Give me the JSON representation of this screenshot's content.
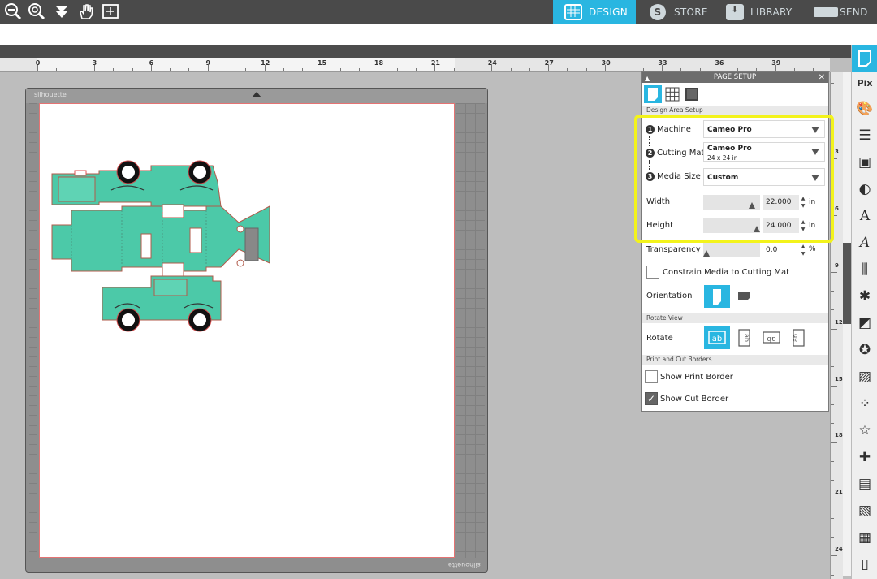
{
  "nav": {
    "tabs": [
      {
        "label": "DESIGN",
        "icon": "grid-icon",
        "active": true
      },
      {
        "label": "STORE",
        "icon": "store-s-icon",
        "active": false
      },
      {
        "label": "LIBRARY",
        "icon": "library-icon",
        "active": false
      },
      {
        "label": "SEND",
        "icon": "send-cutter-icon",
        "active": false
      }
    ],
    "tools": [
      "zoom-out-icon",
      "zoom-select-icon",
      "pan-down-icon",
      "hand-icon",
      "fit-page-icon"
    ]
  },
  "ruler": {
    "labels": [
      "0",
      "3",
      "6",
      "9",
      "12",
      "15",
      "18",
      "21",
      "24",
      "27",
      "30",
      "33",
      "36",
      "39"
    ],
    "vlabels": [
      "3",
      "6",
      "9",
      "12",
      "15",
      "18",
      "21",
      "24"
    ]
  },
  "mat": {
    "brand_top": "silhouette",
    "brand_bottom": "silhouette"
  },
  "panel": {
    "title": "PAGE SETUP",
    "section_design": "Design Area Setup",
    "machine": {
      "num": "1",
      "label": "Machine",
      "value": "Cameo Pro"
    },
    "cutting_mat": {
      "num": "2",
      "label": "Cutting Mat",
      "value": "Cameo Pro",
      "sub": "24 x 24 in"
    },
    "media_size": {
      "num": "3",
      "label": "Media Size",
      "value": "Custom"
    },
    "width": {
      "label": "Width",
      "value": "22.000",
      "unit": "in"
    },
    "height": {
      "label": "Height",
      "value": "24.000",
      "unit": "in"
    },
    "transparency": {
      "label": "Transparency",
      "value": "0.0",
      "unit": "%"
    },
    "constrain_label": "Constrain Media to Cutting Mat",
    "orientation_label": "Orientation",
    "section_rotate": "Rotate View",
    "rotate_label": "Rotate",
    "rotate_options": [
      "ab",
      "ab",
      "ab",
      "ab"
    ],
    "section_borders": "Print and Cut Borders",
    "show_print_border": {
      "label": "Show Print Border",
      "checked": false
    },
    "show_cut_border": {
      "label": "Show Cut Border",
      "checked": true
    }
  },
  "colors": {
    "accent": "#29b6e1",
    "truck": "#4cc9a8",
    "highlight": "#f3f31b"
  },
  "sidebar": {
    "tools": [
      "page-setup-icon",
      "pixscan-icon",
      "fill-palette-icon",
      "line-style-icon",
      "image-effects-icon",
      "transparency-icon",
      "text-style-icon",
      "sketch-icon",
      "align-icon",
      "replicate-icon",
      "modify-icon",
      "offset-icon",
      "trace-icon",
      "rhinestone-icon",
      "design-store-icon",
      "puzzle-icon",
      "flexi-icon",
      "hatch-icon",
      "nesting-icon",
      "library-book-icon"
    ]
  }
}
